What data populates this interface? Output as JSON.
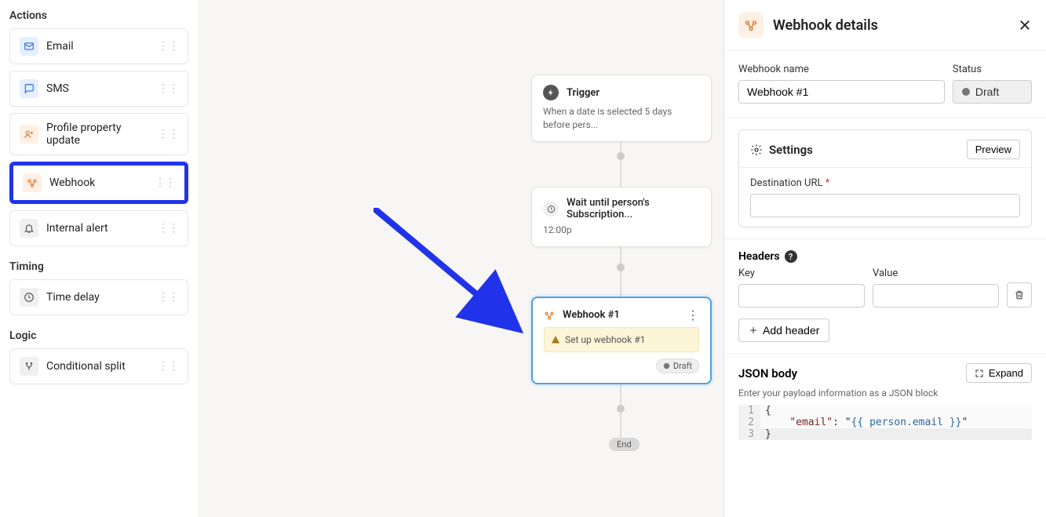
{
  "sidebar": {
    "sections": {
      "actions": {
        "title": "Actions",
        "items": [
          {
            "label": "Email"
          },
          {
            "label": "SMS"
          },
          {
            "label": "Profile property update"
          },
          {
            "label": "Webhook"
          },
          {
            "label": "Internal alert"
          }
        ]
      },
      "timing": {
        "title": "Timing",
        "items": [
          {
            "label": "Time delay"
          }
        ]
      },
      "logic": {
        "title": "Logic",
        "items": [
          {
            "label": "Conditional split"
          }
        ]
      }
    }
  },
  "canvas": {
    "trigger": {
      "title": "Trigger",
      "subtitle": "When a date is selected 5 days before pers..."
    },
    "wait": {
      "title": "Wait until person's Subscription...",
      "time": "12:00p"
    },
    "webhook_node": {
      "title": "Webhook #1",
      "warning": "Set up webhook #1",
      "status": "Draft"
    },
    "end": "End"
  },
  "details": {
    "title": "Webhook details",
    "name_label": "Webhook name",
    "name_value": "Webhook #1",
    "status_label": "Status",
    "status_value": "Draft",
    "settings_title": "Settings",
    "preview_btn": "Preview",
    "dest_url_label": "Destination URL",
    "headers_title": "Headers",
    "key_label": "Key",
    "value_label": "Value",
    "add_header_btn": "Add header",
    "json_title": "JSON body",
    "expand_btn": "Expand",
    "json_help": "Enter your payload information as a JSON block",
    "json_lines": [
      {
        "n": "1",
        "content": "{"
      },
      {
        "n": "2",
        "content": "    \"email\": \"{{ person.email }}\""
      },
      {
        "n": "3",
        "content": "}"
      }
    ]
  }
}
